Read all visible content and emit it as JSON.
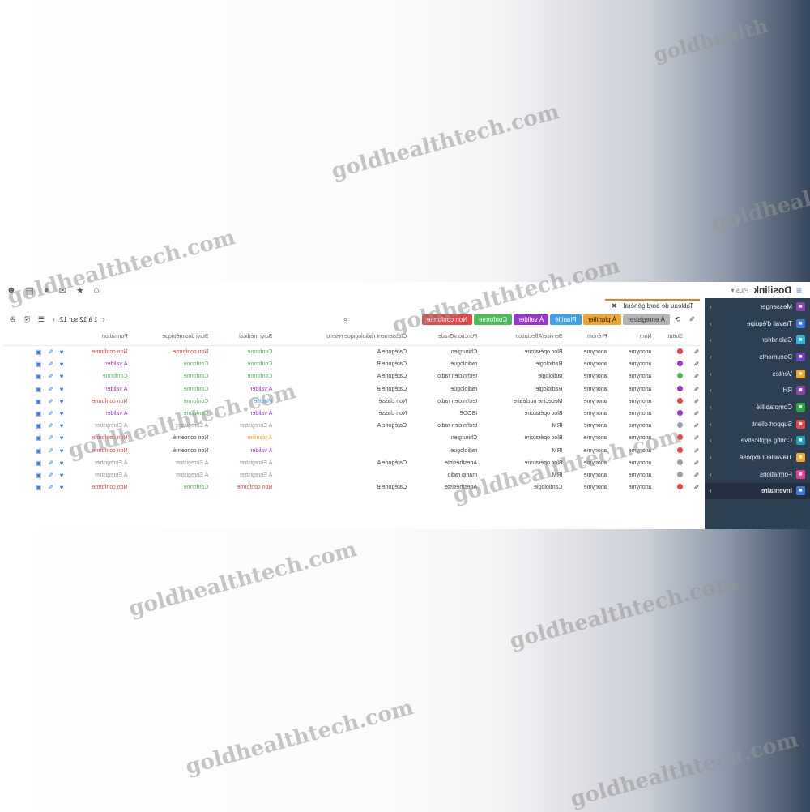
{
  "watermark": "goldhealthtech.com",
  "watermark_partial": "goldhealth",
  "app": {
    "brand": "Dosilink",
    "plus_label": "Plus ▾",
    "menu_icon": "hamburger-icon",
    "top_icons": [
      "home-icon",
      "star-icon",
      "envelope-icon",
      "bell-icon",
      "document-icon",
      "user-icon"
    ]
  },
  "sidebar": {
    "items": [
      {
        "label": "Messenger",
        "icon": "chat-icon",
        "color": "#8e44ad"
      },
      {
        "label": "Travail d'équipe",
        "icon": "team-icon",
        "color": "#3b7bd8"
      },
      {
        "label": "Calendrier",
        "icon": "calendar-icon",
        "color": "#2bb6d9"
      },
      {
        "label": "Documents",
        "icon": "folder-icon",
        "color": "#6f42c1"
      },
      {
        "label": "Ventes",
        "icon": "chart-icon",
        "color": "#f0a62c"
      },
      {
        "label": "RH",
        "icon": "people-icon",
        "color": "#8e44ad"
      },
      {
        "label": "Comptabilité",
        "icon": "ledger-icon",
        "color": "#28a745"
      },
      {
        "label": "Support client",
        "icon": "lifebuoy-icon",
        "color": "#e34848"
      },
      {
        "label": "Config applicative",
        "icon": "gear-icon",
        "color": "#17a2b8"
      },
      {
        "label": "Travailleur exposé",
        "icon": "worker-icon",
        "color": "#f0a62c"
      },
      {
        "label": "Formations",
        "icon": "graduation-icon",
        "color": "#e83e8c"
      },
      {
        "label": "Inventaire",
        "icon": "box-icon",
        "color": "#3b7bd8",
        "active": true
      }
    ]
  },
  "tab": {
    "label": "Tableau de bord général",
    "close": "✖"
  },
  "filters": [
    {
      "label": "À enregistrer",
      "cls": "enreg"
    },
    {
      "label": "À planifier",
      "cls": "planif"
    },
    {
      "label": "Planifié",
      "cls": "planifie"
    },
    {
      "label": "À valider",
      "cls": "valider"
    },
    {
      "label": "Conforme",
      "cls": "conforme"
    },
    {
      "label": "Non conforme",
      "cls": "nonconf"
    }
  ],
  "pager": {
    "text": "1 à 12 sur 12"
  },
  "columns": [
    "",
    "Statut",
    "Nom",
    "Prénom",
    "Service/Affectation",
    "Fonction/Grade",
    "Classement radiologique retenu",
    "Suivi médical",
    "Suivi dosimétrique",
    "Formation",
    ""
  ],
  "status_colors": {
    "red": "#e34848",
    "purple": "#9b35d0",
    "green": "#4cbb5a",
    "grey": "#9aa0a6"
  },
  "value_colors": {
    "Conforme": "#4cbb5a",
    "Non conforme": "#e34848",
    "À valider": "#9b35d0",
    "Planifié": "#3c9ff0",
    "À planifier": "#f0a62c",
    "À Enregistrer": "#999999",
    "Non concerné": "#444444"
  },
  "rows": [
    {
      "status": "red",
      "nom": "anonyme",
      "prenom": "anonyme",
      "service": "Bloc opératoire",
      "fonction": "Chirurgien",
      "classement": "Catégorie A",
      "medical": "Conforme",
      "dosi": "Non conforme",
      "formation": "Non conforme"
    },
    {
      "status": "purple",
      "nom": "anonyme",
      "prenom": "anonyme",
      "service": "Radiologie",
      "fonction": "radiologue",
      "classement": "Catégorie B",
      "medical": "Conforme",
      "dosi": "Conforme",
      "formation": "À valider"
    },
    {
      "status": "green",
      "nom": "anonyme",
      "prenom": "anonyme",
      "service": "radiologie",
      "fonction": "technicien radio",
      "classement": "Catégorie A",
      "medical": "Conforme",
      "dosi": "Conforme",
      "formation": "Conforme"
    },
    {
      "status": "purple",
      "nom": "anonyme",
      "prenom": "anonyme",
      "service": "Radiologie",
      "fonction": "radiologue",
      "classement": "Catégorie B",
      "medical": "À valider",
      "dosi": "Conforme",
      "formation": "À valider"
    },
    {
      "status": "red",
      "nom": "anonyme",
      "prenom": "anonyme",
      "service": "Médecine nucléaire",
      "fonction": "technicien radio",
      "classement": "Non classé",
      "medical": "Planifié",
      "dosi": "Conforme",
      "formation": "Non conforme"
    },
    {
      "status": "purple",
      "nom": "anonyme",
      "prenom": "anonyme",
      "service": "Bloc opératoire",
      "fonction": "IBODE",
      "classement": "Non classé",
      "medical": "À valider",
      "dosi": "Conforme",
      "formation": "À valider"
    },
    {
      "status": "grey",
      "nom": "anonyme",
      "prenom": "anonyme",
      "service": "IRM",
      "fonction": "technicien radio",
      "classement": "Catégorie A",
      "medical": "À Enregistrer",
      "dosi": "À Enregistrer",
      "formation": "À Enregistrer"
    },
    {
      "status": "red",
      "nom": "anonyme",
      "prenom": "anonyme",
      "service": "Bloc opératoire",
      "fonction": "Chirurgien",
      "classement": "",
      "medical": "À planifier",
      "dosi": "Non concerné",
      "formation": "Non conforme"
    },
    {
      "status": "red",
      "nom": "anonyme",
      "prenom": "anonyme",
      "service": "IRM",
      "fonction": "radiologue",
      "classement": "",
      "medical": "À valider",
      "dosi": "Non concerné",
      "formation": "Non conforme"
    },
    {
      "status": "grey",
      "nom": "anonyme",
      "prenom": "anonyme",
      "service": "Bloc opératoire",
      "fonction": "Anesthésiste",
      "classement": "Catégorie A",
      "medical": "À Enregistrer",
      "dosi": "À Enregistrer",
      "formation": "À Enregistrer"
    },
    {
      "status": "grey",
      "nom": "anonyme",
      "prenom": "anonyme",
      "service": "IRM",
      "fonction": "manip radio",
      "classement": "",
      "medical": "À Enregistrer",
      "dosi": "À Enregistrer",
      "formation": "À Enregistrer"
    },
    {
      "status": "red",
      "nom": "anonyme",
      "prenom": "anonyme",
      "service": "Cardiologie",
      "fonction": "Anesthésiste",
      "classement": "Catégorie B",
      "medical": "Non conforme",
      "dosi": "Conforme",
      "formation": "Non conforme"
    }
  ]
}
